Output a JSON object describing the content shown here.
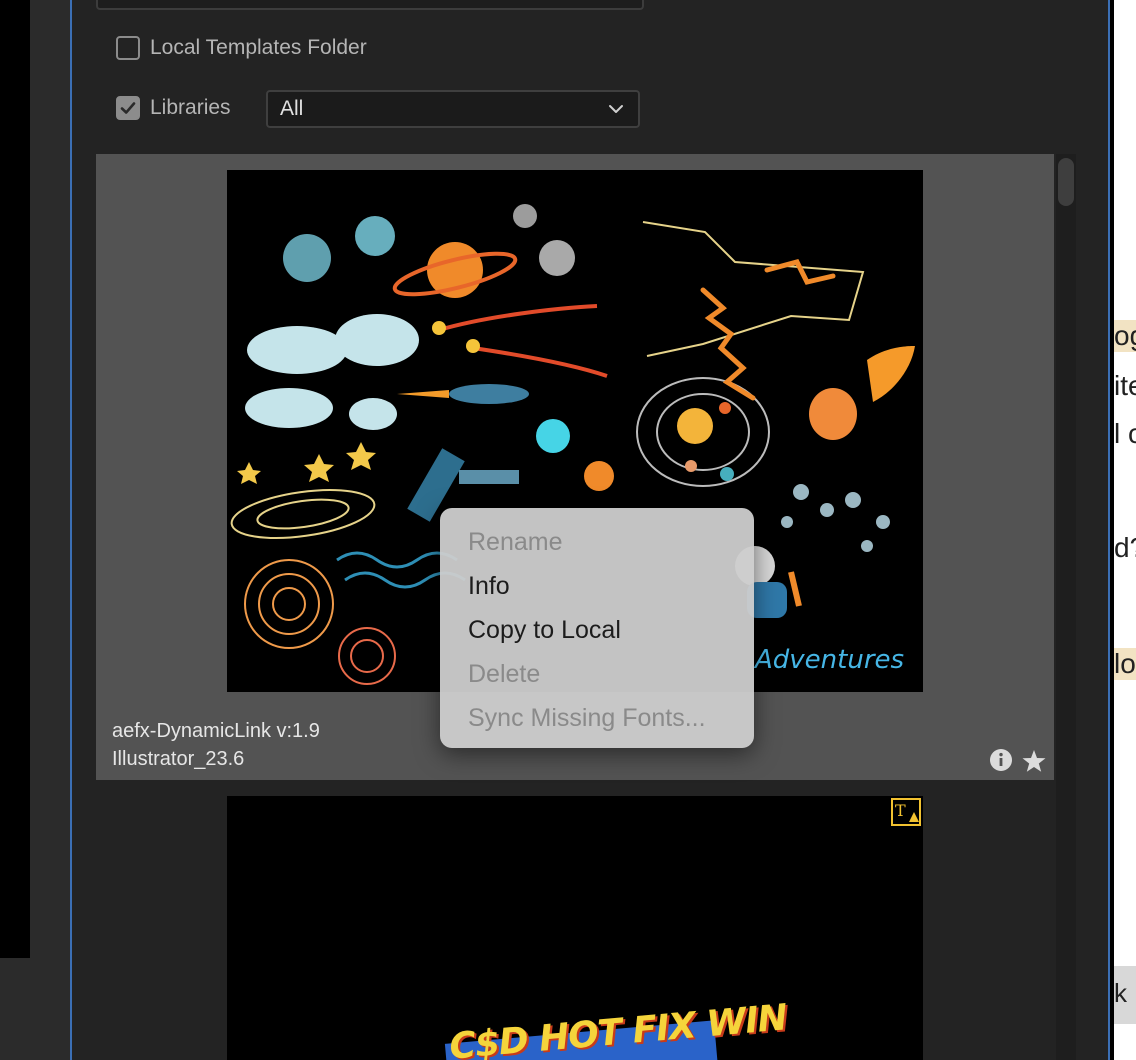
{
  "panel": {
    "checkboxes": [
      {
        "label": "Local Templates Folder",
        "checked": false
      },
      {
        "label": "Libraries",
        "checked": true
      }
    ],
    "libraries_select": {
      "value": "All"
    }
  },
  "cards": [
    {
      "name": "aefx-DynamicLink  v:1.9",
      "app": "Illustrator_23.6",
      "thumbnail_caption": "Adventures",
      "icons": [
        "info-icon",
        "star-icon"
      ]
    },
    {
      "thumbnail_text": "C$D HOT FIX WIN",
      "badge": "missing-font-warning-icon"
    }
  ],
  "context_menu": {
    "items": [
      {
        "label": "Rename",
        "enabled": false
      },
      {
        "label": "Info",
        "enabled": true
      },
      {
        "label": "Copy to Local",
        "enabled": true
      },
      {
        "label": "Delete",
        "enabled": false
      },
      {
        "label": "Sync Missing Fonts...",
        "enabled": false
      }
    ]
  },
  "background_doc": {
    "fragments": [
      "og",
      "ite",
      "l c",
      "d?",
      "lo",
      "k"
    ]
  },
  "colors": {
    "panel_bg": "#232323",
    "card_bg": "#535353",
    "accent_border": "#3b6fb5",
    "menu_bg": "#cdcdcd"
  }
}
